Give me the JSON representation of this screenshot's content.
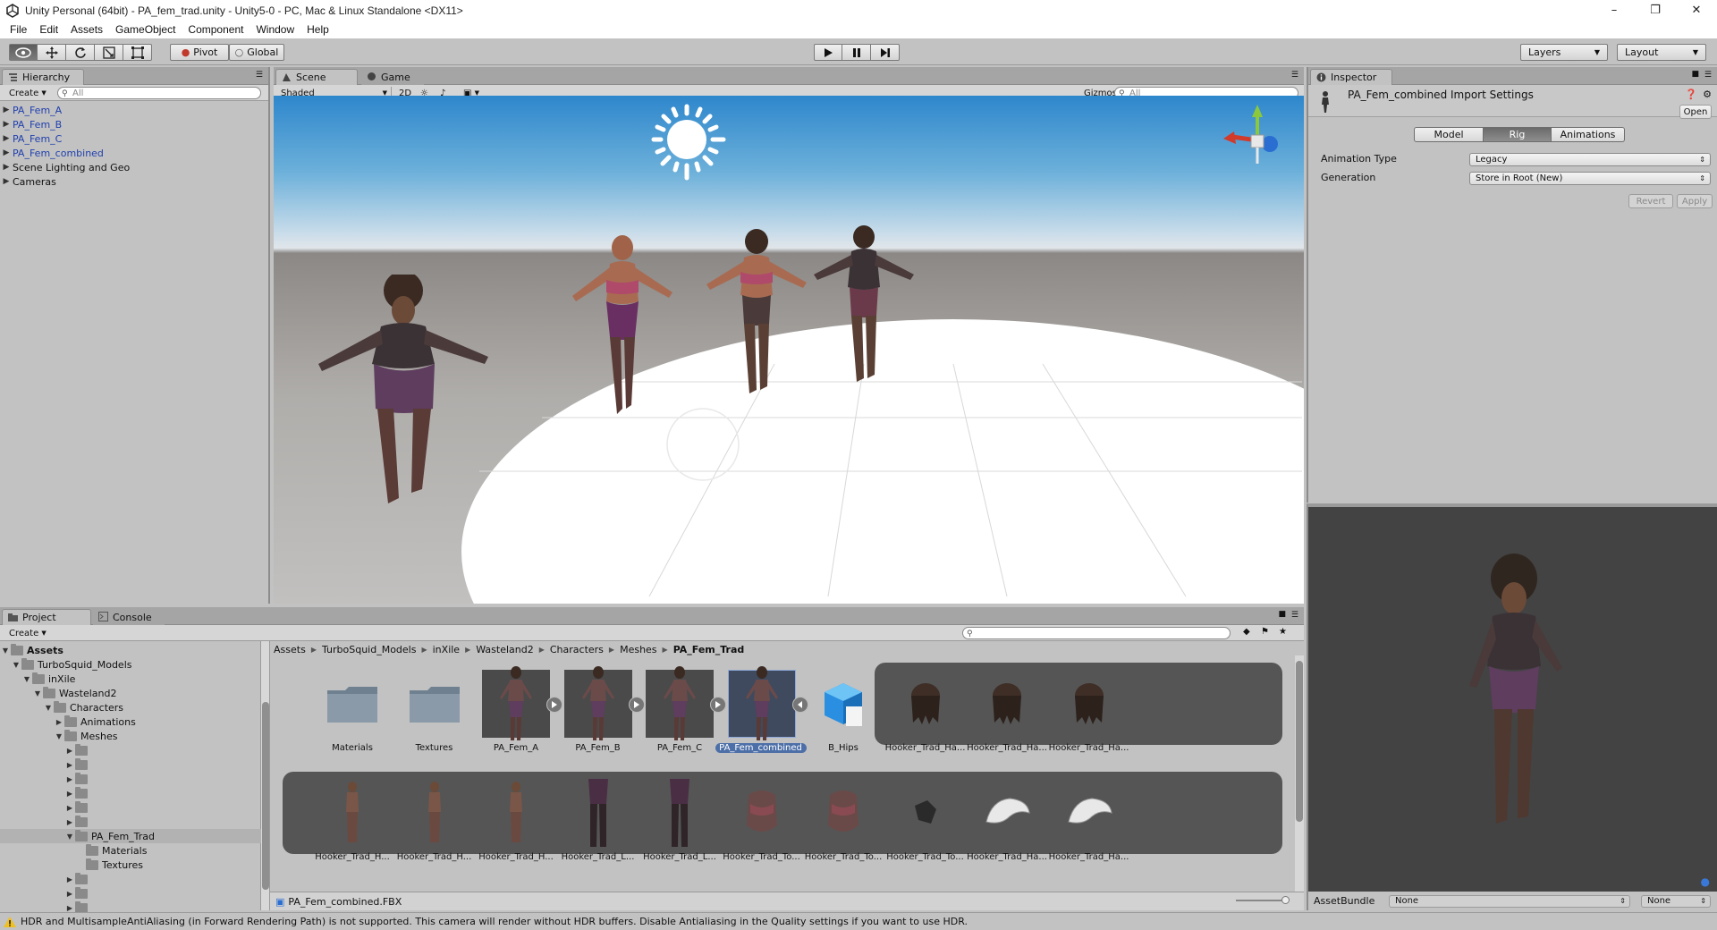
{
  "window": {
    "title": "Unity Personal (64bit) - PA_fem_trad.unity - Unity5-0 - PC, Mac & Linux Standalone <DX11>"
  },
  "menu": [
    "File",
    "Edit",
    "Assets",
    "GameObject",
    "Component",
    "Window",
    "Help"
  ],
  "toolbar": {
    "pivot_label": "Pivot",
    "global_label": "Global",
    "layers_label": "Layers",
    "layout_label": "Layout"
  },
  "hierarchy": {
    "tab_label": "Hierarchy",
    "create_label": "Create",
    "search_placeholder": "All",
    "items": [
      {
        "label": "PA_Fem_A",
        "prefab": true
      },
      {
        "label": "PA_Fem_B",
        "prefab": true
      },
      {
        "label": "PA_Fem_C",
        "prefab": true
      },
      {
        "label": "PA_Fem_combined",
        "prefab": true
      },
      {
        "label": "Scene Lighting and Geo",
        "prefab": false
      },
      {
        "label": "Cameras",
        "prefab": false
      }
    ]
  },
  "scene": {
    "tab_scene": "Scene",
    "tab_game": "Game",
    "shading_mode": "Shaded",
    "mode_2d": "2D",
    "gizmos_label": "Gizmos",
    "search_placeholder": "All"
  },
  "inspector": {
    "tab_label": "Inspector",
    "title": "PA_Fem_combined Import Settings",
    "open_label": "Open",
    "tabs": [
      "Model",
      "Rig",
      "Animations"
    ],
    "active_tab": "Rig",
    "animation_type_label": "Animation Type",
    "animation_type_value": "Legacy",
    "generation_label": "Generation",
    "generation_value": "Store in Root (New)",
    "revert_label": "Revert",
    "apply_label": "Apply"
  },
  "preview": {
    "assetbundle_label": "AssetBundle",
    "bundle_value": "None",
    "variant_value": "None"
  },
  "project": {
    "tab_project": "Project",
    "tab_console": "Console",
    "create_label": "Create",
    "tree": [
      {
        "label": "Assets",
        "depth": 0,
        "bold": true
      },
      {
        "label": "TurboSquid_Models",
        "depth": 1
      },
      {
        "label": "inXile",
        "depth": 2
      },
      {
        "label": "Wasteland2",
        "depth": 3
      },
      {
        "label": "Characters",
        "depth": 4
      },
      {
        "label": "Animations",
        "depth": 5
      },
      {
        "label": "Meshes",
        "depth": 5
      },
      {
        "label": "",
        "depth": 6
      },
      {
        "label": "",
        "depth": 6
      },
      {
        "label": "",
        "depth": 6
      },
      {
        "label": "",
        "depth": 6
      },
      {
        "label": "",
        "depth": 6
      },
      {
        "label": "",
        "depth": 6
      },
      {
        "label": "PA_Fem_Trad",
        "depth": 6,
        "selected": true
      },
      {
        "label": "Materials",
        "depth": 7
      },
      {
        "label": "Textures",
        "depth": 7
      },
      {
        "label": "",
        "depth": 6
      },
      {
        "label": "",
        "depth": 6
      },
      {
        "label": "",
        "depth": 6
      }
    ],
    "breadcrumb": [
      "Assets",
      "TurboSquid_Models",
      "inXile",
      "Wasteland2",
      "Characters",
      "Meshes",
      "PA_Fem_Trad"
    ],
    "row1": [
      {
        "label": "Materials",
        "kind": "folder"
      },
      {
        "label": "Textures",
        "kind": "folder"
      },
      {
        "label": "PA_Fem_A",
        "kind": "model"
      },
      {
        "label": "PA_Fem_B",
        "kind": "model"
      },
      {
        "label": "PA_Fem_C",
        "kind": "model"
      },
      {
        "label": "PA_Fem_combined",
        "kind": "model-selected"
      },
      {
        "label": "B_Hips",
        "kind": "cube"
      },
      {
        "label": "Hooker_Trad_Ha...",
        "kind": "hair"
      },
      {
        "label": "Hooker_Trad_Ha...",
        "kind": "hair"
      },
      {
        "label": "Hooker_Trad_Ha...",
        "kind": "hair"
      }
    ],
    "row2": [
      {
        "label": "Hooker_Trad_H...",
        "kind": "body"
      },
      {
        "label": "Hooker_Trad_H...",
        "kind": "body"
      },
      {
        "label": "Hooker_Trad_H...",
        "kind": "body"
      },
      {
        "label": "Hooker_Trad_L...",
        "kind": "legs"
      },
      {
        "label": "Hooker_Trad_L...",
        "kind": "legs"
      },
      {
        "label": "Hooker_Trad_To...",
        "kind": "torso"
      },
      {
        "label": "Hooker_Trad_To...",
        "kind": "torso"
      },
      {
        "label": "Hooker_Trad_To...",
        "kind": "torso-small"
      },
      {
        "label": "Hooker_Trad_Ha...",
        "kind": "hair-white"
      },
      {
        "label": "Hooker_Trad_Ha...",
        "kind": "hair-white"
      }
    ],
    "footer_file": "PA_Fem_combined.FBX"
  },
  "status": {
    "message": "HDR and MultisampleAntiAliasing (in Forward Rendering Path) is not supported. This camera will render without HDR buffers. Disable Antialiasing in the Quality settings if you want to use HDR."
  },
  "colors": {
    "prefab_text": "#1f3fae",
    "panel_bg": "#c2c2c2",
    "selection": "#4d6fa8",
    "warning": "#f0c020"
  }
}
